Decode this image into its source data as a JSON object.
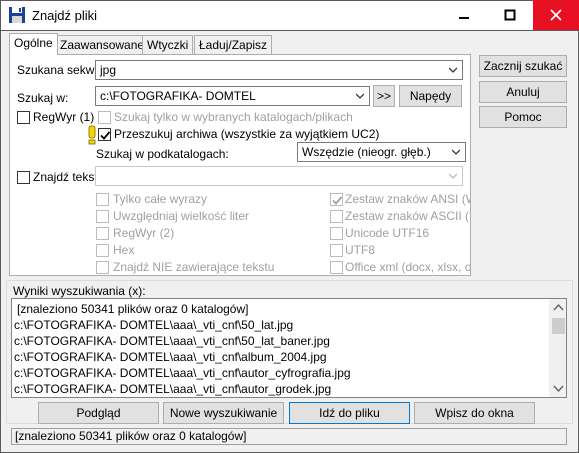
{
  "window": {
    "title": "Znajdź pliki"
  },
  "tabs": [
    "Ogólne",
    "Zaawansowane",
    "Wtyczki",
    "Ładuj/Zapisz"
  ],
  "general": {
    "search_label": "Szukana sekw.:",
    "search_value": "jpg",
    "location_label": "Szukaj w:",
    "location_value": "c:\\FOTOGRAFIKA- DOMTEL",
    "browse_btn": ">>",
    "drives_btn": "Napędy",
    "regex1": "RegWyr (1)",
    "only_selected": "Szukaj tylko w wybranych katalogach/plikach",
    "archives": "Przeszukuj archiwa (wszystkie za wyjątkiem UC2)",
    "subdirs_label": "Szukaj w podkatalogach:",
    "subdirs_value": "Wszędzie (nieogr. głęb.)",
    "find_text": "Znajdź tekst:",
    "whole_words": "Tylko całe wyrazy",
    "case": "Uwzględniaj wielkość liter",
    "regex2": "RegWyr (2)",
    "hex": "Hex",
    "not_containing": "Znajdź NIE zawierające tekstu",
    "ansi": "Zestaw znaków ANSI (Win)",
    "ascii": "Zestaw znaków ASCII (DOS)",
    "utf16": "Unicode UTF16",
    "utf8": "UTF8",
    "office": "Office xml (docx, xlsx, odt i"
  },
  "side_buttons": {
    "start": "Zacznij szukać",
    "cancel": "Anuluj",
    "help": "Pomoc"
  },
  "results": {
    "label": "Wyniki wyszukiwania (x):",
    "rows": [
      "[znaleziono 50341 plików oraz 0 katalogów]",
      "c:\\FOTOGRAFIKA- DOMTEL\\aaa\\_vti_cnf\\50_lat.jpg",
      "c:\\FOTOGRAFIKA- DOMTEL\\aaa\\_vti_cnf\\50_lat_baner.jpg",
      "c:\\FOTOGRAFIKA- DOMTEL\\aaa\\_vti_cnf\\album_2004.jpg",
      "c:\\FOTOGRAFIKA- DOMTEL\\aaa\\_vti_cnf\\autor_cyfrografia.jpg",
      "c:\\FOTOGRAFIKA- DOMTEL\\aaa\\_vti_cnf\\autor_grodek.jpg"
    ]
  },
  "bottom_buttons": {
    "view": "Podgląd",
    "new_search": "Nowe wyszukiwanie",
    "goto": "Idź do pliku",
    "feed": "Wpisz do okna"
  },
  "status": "[znaleziono 50341 plików oraz 0 katalogów]"
}
